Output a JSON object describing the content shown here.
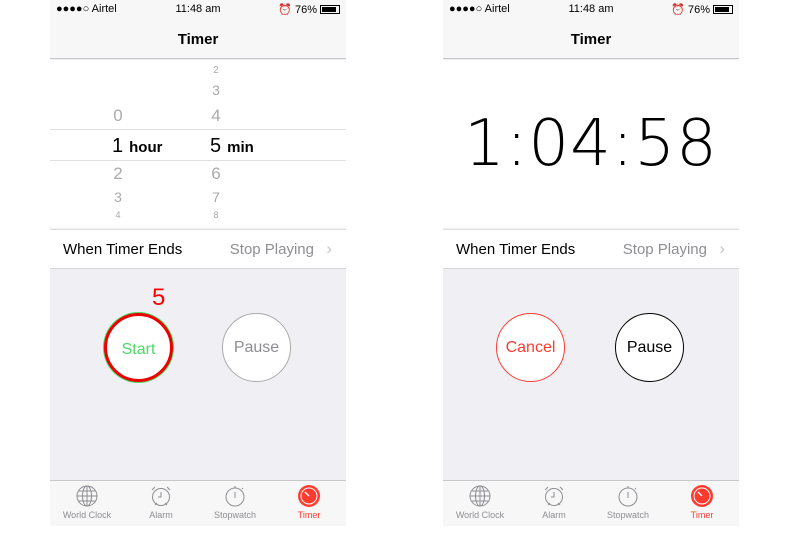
{
  "status": {
    "carrier": "●●●●○ Airtel",
    "time": "11:48 am",
    "battery": "76%",
    "battery_level": 0.76
  },
  "nav_title": "Timer",
  "picker": {
    "hours_above": [
      "0"
    ],
    "hours_below": [
      "2",
      "3",
      "4"
    ],
    "hour_value": "1",
    "hour_unit": "hour",
    "mins_above": [
      "2",
      "3",
      "4"
    ],
    "mins_below": [
      "6",
      "7",
      "8"
    ],
    "min_value": "5",
    "min_unit": "min"
  },
  "countdown": "1:04:58",
  "when_ends": {
    "label": "When Timer Ends",
    "value": "Stop Playing",
    "chevron": "›"
  },
  "left_buttons": {
    "start": "Start",
    "pause": "Pause"
  },
  "right_buttons": {
    "cancel": "Cancel",
    "pause": "Pause"
  },
  "annotation": "5",
  "tabs": [
    {
      "label": "World Clock",
      "icon": "globe-icon"
    },
    {
      "label": "Alarm",
      "icon": "alarm-clock-icon"
    },
    {
      "label": "Stopwatch",
      "icon": "stopwatch-icon"
    },
    {
      "label": "Timer",
      "icon": "timer-icon",
      "active": true
    }
  ],
  "colors": {
    "accent": "#ff3b30",
    "start_green": "#4cd964",
    "annotation_red": "#ff0000"
  }
}
